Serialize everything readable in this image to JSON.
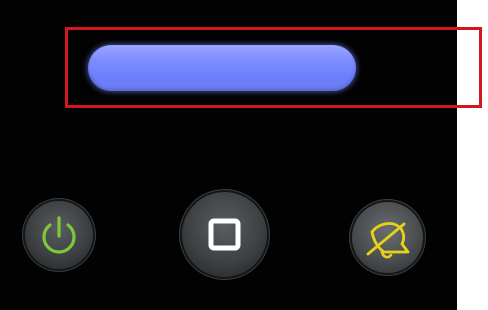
{
  "control_panel": {
    "status_light": {
      "color": "#7c8cff",
      "state": "on"
    },
    "highlight": {
      "color": "#d4171c"
    },
    "buttons": [
      {
        "id": "power",
        "icon": "power-icon",
        "icon_color": "#7ec83a"
      },
      {
        "id": "stop",
        "icon": "stop-square-icon",
        "icon_color": "#ffffff"
      },
      {
        "id": "cancel",
        "icon": "cancel-bell-icon",
        "icon_color": "#e6d21b"
      }
    ]
  }
}
